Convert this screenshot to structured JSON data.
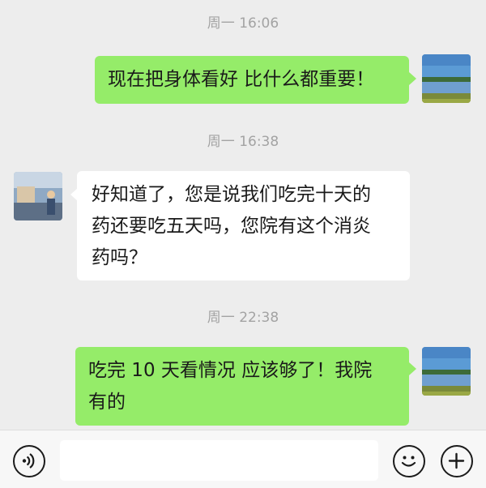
{
  "messages": [
    {
      "type": "time",
      "text": "周一 16:06"
    },
    {
      "type": "sent",
      "text": "现在把身体看好 比什么都重要！",
      "avatar": "lake-avatar"
    },
    {
      "type": "time",
      "text": "周一 16:38"
    },
    {
      "type": "received",
      "text": "好知道了，您是说我们吃完十天的\n药还要吃五天吗，您院有这个消炎\n药吗？",
      "avatar": "person-avatar"
    },
    {
      "type": "time",
      "text": "周一 22:38"
    },
    {
      "type": "sent",
      "text": "吃完 10 天看情况 应该够了！我院\n有的",
      "avatar": "lake-avatar"
    }
  ],
  "input_bar": {
    "voice_icon": "voice-icon",
    "emoji_icon": "emoji-icon",
    "plus_icon": "plus-icon",
    "text_value": ""
  },
  "colors": {
    "background": "#ededed",
    "sent_bubble": "#95ec69",
    "received_bubble": "#ffffff",
    "timestamp": "#a3a3a3"
  }
}
